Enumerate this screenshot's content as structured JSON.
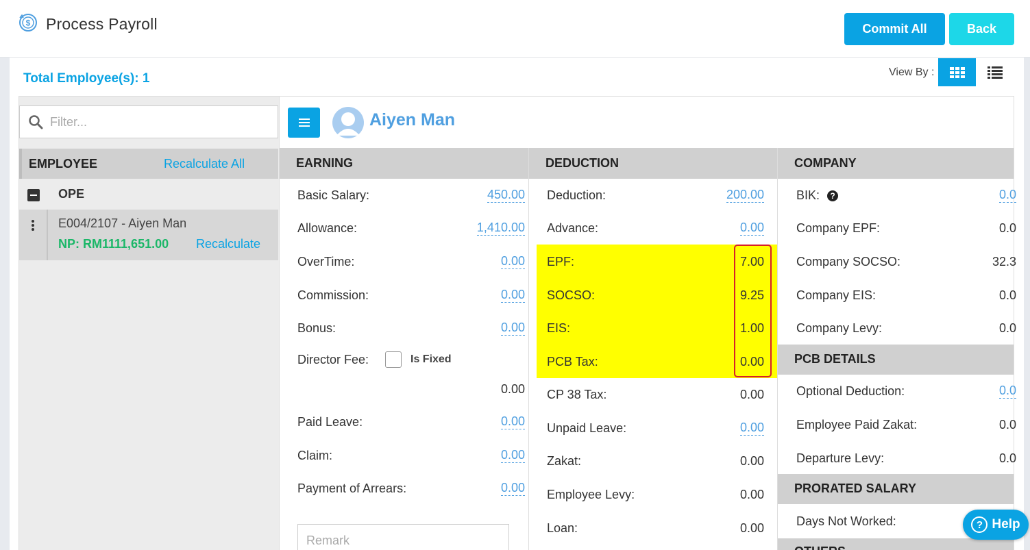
{
  "header": {
    "title": "Process Payroll",
    "commit_label": "Commit All",
    "back_label": "Back"
  },
  "summary": {
    "total_employees": "Total Employee(s): 1",
    "view_by_label": "View By :"
  },
  "filter": {
    "placeholder": "Filter..."
  },
  "employee_list": {
    "header_label": "EMPLOYEE",
    "recalculate_all_label": "Recalculate All",
    "group_label": "OPE",
    "employee": {
      "name": "E004/2107 - Aiyen Man",
      "net_pay": "NP: RM1111,651.00",
      "recalculate_label": "Recalculate"
    }
  },
  "employee_detail": {
    "name": "Aiyen Man"
  },
  "earning": {
    "header": "EARNING",
    "rows": [
      {
        "label": "Basic Salary:",
        "value": "450.00"
      },
      {
        "label": "Allowance:",
        "value": "1,410.00"
      },
      {
        "label": "OverTime:",
        "value": "0.00"
      },
      {
        "label": "Commission:",
        "value": "0.00"
      },
      {
        "label": "Bonus:",
        "value": "0.00"
      },
      {
        "label": "Director Fee:",
        "value": "0.00"
      },
      {
        "label": "Paid Leave:",
        "value": "0.00"
      },
      {
        "label": "Claim:",
        "value": "0.00"
      },
      {
        "label": "Payment of Arrears:",
        "value": "0.00"
      }
    ],
    "is_fixed_label": "Is Fixed",
    "remark_placeholder": "Remark"
  },
  "deduction": {
    "header": "DEDUCTION",
    "rows": [
      {
        "label": "Deduction:",
        "value": "200.00"
      },
      {
        "label": "Advance:",
        "value": "0.00"
      },
      {
        "label": "EPF:",
        "value": "7.00"
      },
      {
        "label": "SOCSO:",
        "value": "9.25"
      },
      {
        "label": "EIS:",
        "value": "1.00"
      },
      {
        "label": "PCB Tax:",
        "value": "0.00"
      },
      {
        "label": "CP 38 Tax:",
        "value": "0.00"
      },
      {
        "label": "Unpaid Leave:",
        "value": "0.00"
      },
      {
        "label": "Zakat:",
        "value": "0.00"
      },
      {
        "label": "Employee Levy:",
        "value": "0.00"
      },
      {
        "label": "Loan:",
        "value": "0.00"
      }
    ]
  },
  "company": {
    "header": "COMPANY",
    "rows": [
      {
        "label": "BIK:",
        "value": "0.0"
      },
      {
        "label": "Company EPF:",
        "value": "0.0"
      },
      {
        "label": "Company SOCSO:",
        "value": "32.3"
      },
      {
        "label": "Company EIS:",
        "value": "0.0"
      },
      {
        "label": "Company Levy:",
        "value": "0.0"
      }
    ],
    "pcb_header": "PCB DETAILS",
    "pcb_rows": [
      {
        "label": "Optional Deduction:",
        "value": "0.0"
      },
      {
        "label": "Employee Paid Zakat:",
        "value": "0.0"
      },
      {
        "label": "Departure Levy:",
        "value": "0.0"
      }
    ],
    "prorated_header": "PRORATED SALARY",
    "prorated_rows": [
      {
        "label": "Days Not Worked:",
        "value": ""
      }
    ],
    "others_header": "OTHERS"
  },
  "help_label": "Help",
  "colors": {
    "accent": "#0aa3e3",
    "accent_light": "#1dd7e8",
    "highlight": "#ffff00",
    "success": "#1bb768",
    "link": "#4f9fe0"
  }
}
